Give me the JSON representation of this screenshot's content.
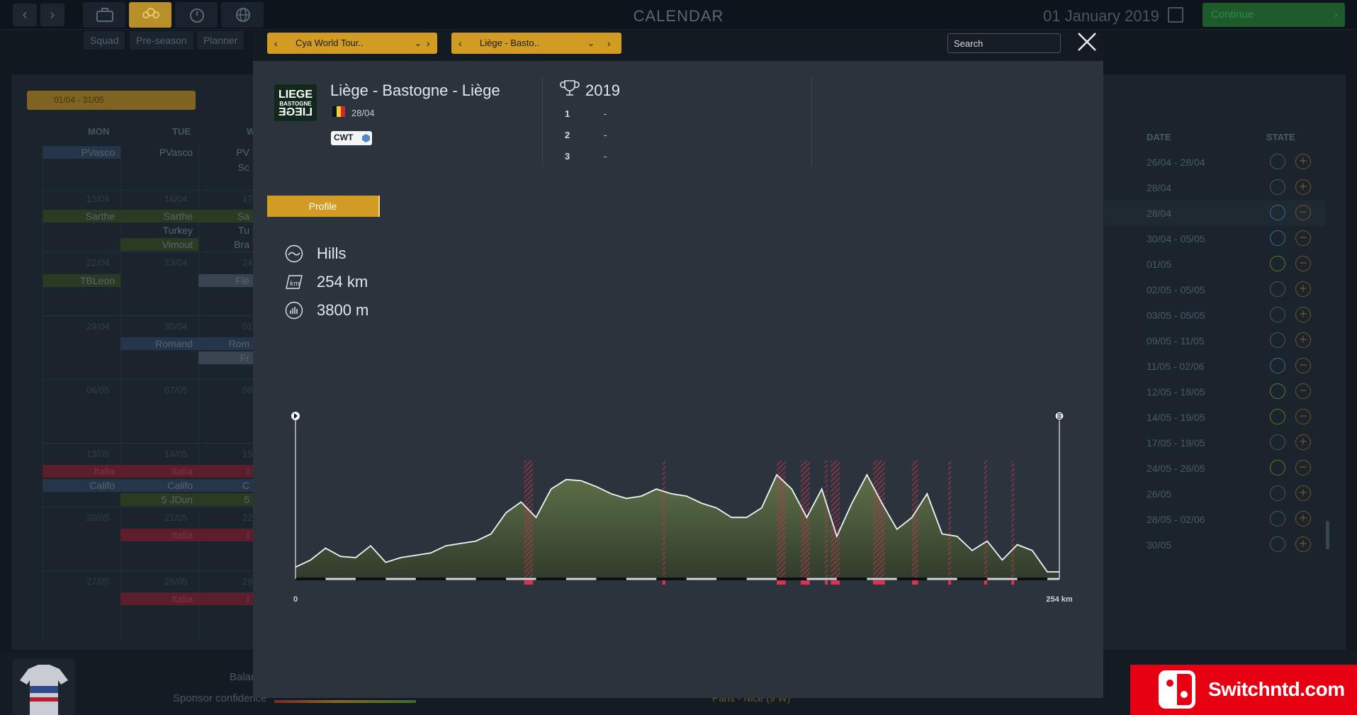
{
  "app": {
    "title": "CALENDAR",
    "date": "01 January 2019",
    "continue_label": "Continue",
    "subtabs": [
      "Squad",
      "Pre-season",
      "Planner"
    ]
  },
  "background": {
    "date_range": "01/04 - 31/05",
    "day_headers": [
      "MON",
      "TUE",
      "W"
    ],
    "week_dates": [
      [
        "15/04",
        "16/04",
        "17"
      ],
      [
        "22/04",
        "23/04",
        "24"
      ],
      [
        "29/04",
        "30/04",
        "01"
      ],
      [
        "06/05",
        "07/05",
        "08"
      ],
      [
        "13/05",
        "14/05",
        "15"
      ],
      [
        "20/05",
        "21/05",
        "22"
      ],
      [
        "27/05",
        "28/05",
        "29"
      ]
    ],
    "calendar_races": {
      "r1": [
        "PVasco",
        "PVasco",
        "PV"
      ],
      "r1b": "Sc",
      "r2": [
        "Sarthe",
        "Sarthe",
        "Sa"
      ],
      "r2b": [
        "Turkey",
        "Tu"
      ],
      "r2c": [
        "Vimout",
        "Bra"
      ],
      "r3": [
        "TBLeon",
        "Flè"
      ],
      "r4": [
        "Romand",
        "Rom"
      ],
      "r4b": "Fr",
      "r5": [
        "Italia",
        "Italia",
        "I"
      ],
      "r5b": [
        "Califo",
        "Califo",
        "C"
      ],
      "r5c": [
        "5 JDun",
        "5"
      ],
      "r6": [
        "Italia",
        "I"
      ],
      "r7": [
        "Italia",
        "I"
      ]
    },
    "list_headers": {
      "date": "DATE",
      "state": "STATE"
    },
    "list_dates": [
      "26/04 - 28/04",
      "28/04",
      "28/04",
      "30/04 - 05/05",
      "01/05",
      "02/05 - 05/05",
      "03/05 - 05/05",
      "09/05 - 11/05",
      "11/05 - 02/06",
      "12/05 - 18/05",
      "14/05 - 19/05",
      "17/05 - 19/05",
      "24/05 - 26/05",
      "26/05",
      "28/05 - 02/06",
      "30/05"
    ],
    "bottom": {
      "balance_label": "Balan",
      "sponsor_label": "Sponsor confidence",
      "next_race": "Paris - Nice (9 W)"
    }
  },
  "modal": {
    "tour_select": "Cya World Tour..",
    "race_select": "Liège - Basto..",
    "search_placeholder": "Search",
    "race": {
      "name": "Liège - Bastogne - Liège",
      "date": "28/04",
      "category": "CWT",
      "logo_lines": [
        "LIEGE",
        "BASTOGNE",
        "LIEGE"
      ]
    },
    "results": {
      "year": "2019",
      "podium": [
        {
          "rank": "1",
          "rider": "-"
        },
        {
          "rank": "2",
          "rider": "-"
        },
        {
          "rank": "3",
          "rider": "-"
        }
      ]
    },
    "tab_profile": "Profile",
    "stats": {
      "terrain": "Hills",
      "distance": "254 km",
      "elevation": "3800 m"
    },
    "icons": {
      "terrain": "hills-icon",
      "distance": "distance-km-icon",
      "elevation": "elevation-icon",
      "start": "start-flag-icon",
      "finish": "finish-flag-icon"
    },
    "colors": {
      "accent": "#d19b24",
      "profile_fill": "#4e5f40",
      "climb_marker": "#d9334f"
    }
  },
  "chart_data": {
    "type": "area",
    "title": "",
    "xlabel": "",
    "ylabel": "",
    "x_tick_labels": [
      "0",
      "254 km"
    ],
    "xlim": [
      0,
      254
    ],
    "x": [
      0,
      5,
      10,
      15,
      20,
      25,
      30,
      35,
      40,
      45,
      50,
      55,
      60,
      65,
      70,
      75,
      80,
      85,
      90,
      95,
      100,
      105,
      110,
      115,
      120,
      125,
      130,
      135,
      140,
      145,
      150,
      155,
      160,
      165,
      170,
      175,
      180,
      185,
      190,
      195,
      200,
      205,
      210,
      215,
      220,
      225,
      230,
      235,
      240,
      245,
      250,
      254
    ],
    "y": [
      100,
      160,
      260,
      190,
      180,
      280,
      140,
      180,
      200,
      220,
      280,
      300,
      320,
      380,
      560,
      650,
      520,
      760,
      840,
      830,
      780,
      720,
      680,
      700,
      760,
      720,
      700,
      640,
      600,
      520,
      520,
      600,
      880,
      760,
      520,
      760,
      360,
      640,
      880,
      640,
      420,
      520,
      720,
      380,
      360,
      240,
      320,
      160,
      290,
      240,
      60,
      60
    ],
    "climbs_km": [
      [
        76,
        79
      ],
      [
        122,
        123
      ],
      [
        160,
        163
      ],
      [
        168,
        171
      ],
      [
        176,
        177
      ],
      [
        178,
        181
      ],
      [
        192,
        196
      ],
      [
        205,
        207
      ],
      [
        217,
        218
      ],
      [
        229,
        230
      ],
      [
        238,
        239
      ]
    ],
    "sectors_km": [
      [
        10,
        20
      ],
      [
        30,
        40
      ],
      [
        50,
        60
      ],
      [
        70,
        80
      ],
      [
        90,
        100
      ],
      [
        110,
        120
      ],
      [
        130,
        140
      ],
      [
        150,
        160
      ],
      [
        170,
        180
      ],
      [
        190,
        200
      ],
      [
        210,
        220
      ],
      [
        230,
        240
      ],
      [
        250,
        254
      ]
    ]
  }
}
